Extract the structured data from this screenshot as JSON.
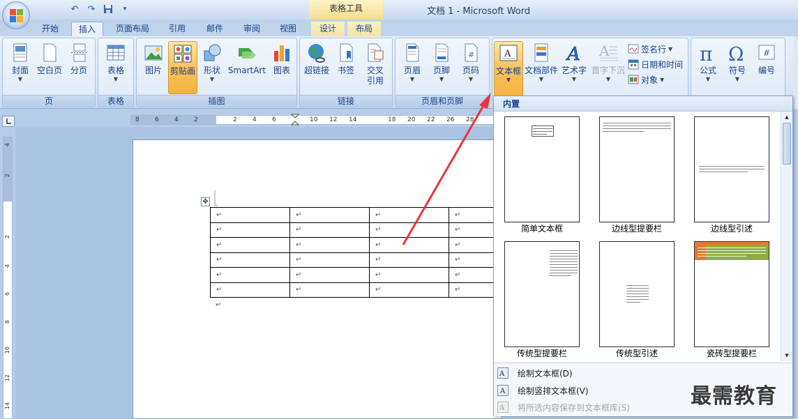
{
  "window": {
    "title": "文档 1 - Microsoft Word",
    "context_tab_group": "表格工具"
  },
  "tabs": [
    {
      "label": "开始"
    },
    {
      "label": "插入"
    },
    {
      "label": "页面布局"
    },
    {
      "label": "引用"
    },
    {
      "label": "邮件"
    },
    {
      "label": "审阅"
    },
    {
      "label": "视图"
    },
    {
      "label": "设计"
    },
    {
      "label": "布局"
    }
  ],
  "ribbon": {
    "groups": {
      "page": {
        "label": "页",
        "cover": "封面",
        "blank": "空白页",
        "pagebreak": "分页"
      },
      "table": {
        "label": "表格",
        "table": "表格"
      },
      "illustrations": {
        "label": "插图",
        "picture": "图片",
        "clipart": "剪贴画",
        "shapes": "形状",
        "smartart": "SmartArt",
        "chart": "图表"
      },
      "links": {
        "label": "链接",
        "hyperlink": "超链接",
        "bookmark": "书签",
        "crossref_line1": "交叉",
        "crossref_line2": "引用"
      },
      "header_footer": {
        "label": "页眉和页脚",
        "header": "页眉",
        "footer": "页脚",
        "pagenum": "页码"
      },
      "text": {
        "textbox": "文本框",
        "quickparts": "文档部件",
        "wordart": "艺术字",
        "dropcap": "首字下沉",
        "signature": "签名行",
        "datetime": "日期和时间",
        "object": "对象"
      },
      "symbols": {
        "equation": "公式",
        "symbol": "符号",
        "number": "编号"
      }
    }
  },
  "ruler": {
    "h_ticks": [
      "8",
      "6",
      "4",
      "2",
      "2",
      "4",
      "6",
      "10",
      "12",
      "14",
      "18",
      "20",
      "22",
      "26",
      "28"
    ],
    "v_ticks": [
      "4",
      "2",
      "2",
      "4",
      "6",
      "8",
      "10",
      "12",
      "14"
    ]
  },
  "document": {
    "table_rows": 6,
    "table_cols": 4,
    "cell_mark": "↵"
  },
  "textbox_gallery": {
    "section_header": "内置",
    "items": [
      {
        "label": "简单文本框"
      },
      {
        "label": "边线型提要栏"
      },
      {
        "label": "边线型引述"
      },
      {
        "label": "传统型提要栏"
      },
      {
        "label": "传统型引述"
      },
      {
        "label": "瓷砖型提要栏"
      }
    ],
    "menu": [
      {
        "label": "绘制文本框(D)",
        "enabled": true
      },
      {
        "label": "绘制竖排文本框(V)",
        "enabled": true
      },
      {
        "label": "将所选内容保存到文本框库(S)",
        "enabled": false
      }
    ]
  },
  "watermark": "最需教育",
  "colors": {
    "accent": "#15428b",
    "pressed": "#f9c15b",
    "annotation_arrow": "#e8353a"
  }
}
